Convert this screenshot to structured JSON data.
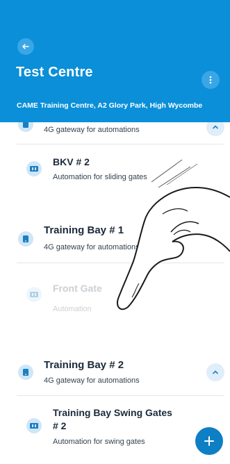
{
  "header": {
    "title": "Test Centre",
    "address": "CAME Training Centre, A2 Glory Park, High Wycombe",
    "back_icon": "arrow-left-icon",
    "menu_icon": "kebab-menu-icon"
  },
  "list": {
    "items": [
      {
        "title": "",
        "subtitle": "4G gateway for automations",
        "icon": "gateway-icon"
      },
      {
        "title": "BKV # 2",
        "subtitle": "Automation for sliding gates",
        "icon": "gate-icon"
      },
      {
        "title": "Training Bay # 1",
        "subtitle": "4G gateway for automations",
        "icon": "gateway-icon"
      },
      {
        "title": "Front Gate",
        "subtitle": "Automation",
        "icon": "gate-icon"
      },
      {
        "title": "Training Bay # 2",
        "subtitle": "4G gateway for automations",
        "icon": "gateway-icon"
      },
      {
        "title_line1": "Training Bay Swing Gates",
        "title_line2": "# 2",
        "subtitle": "Automation for swing gates",
        "icon": "gate-icon"
      }
    ]
  },
  "fab": {
    "icon": "plus-icon"
  },
  "colors": {
    "primary": "#0a8fd8",
    "fab": "#0e7fc4",
    "icon_bg": "#cfe6f7"
  }
}
